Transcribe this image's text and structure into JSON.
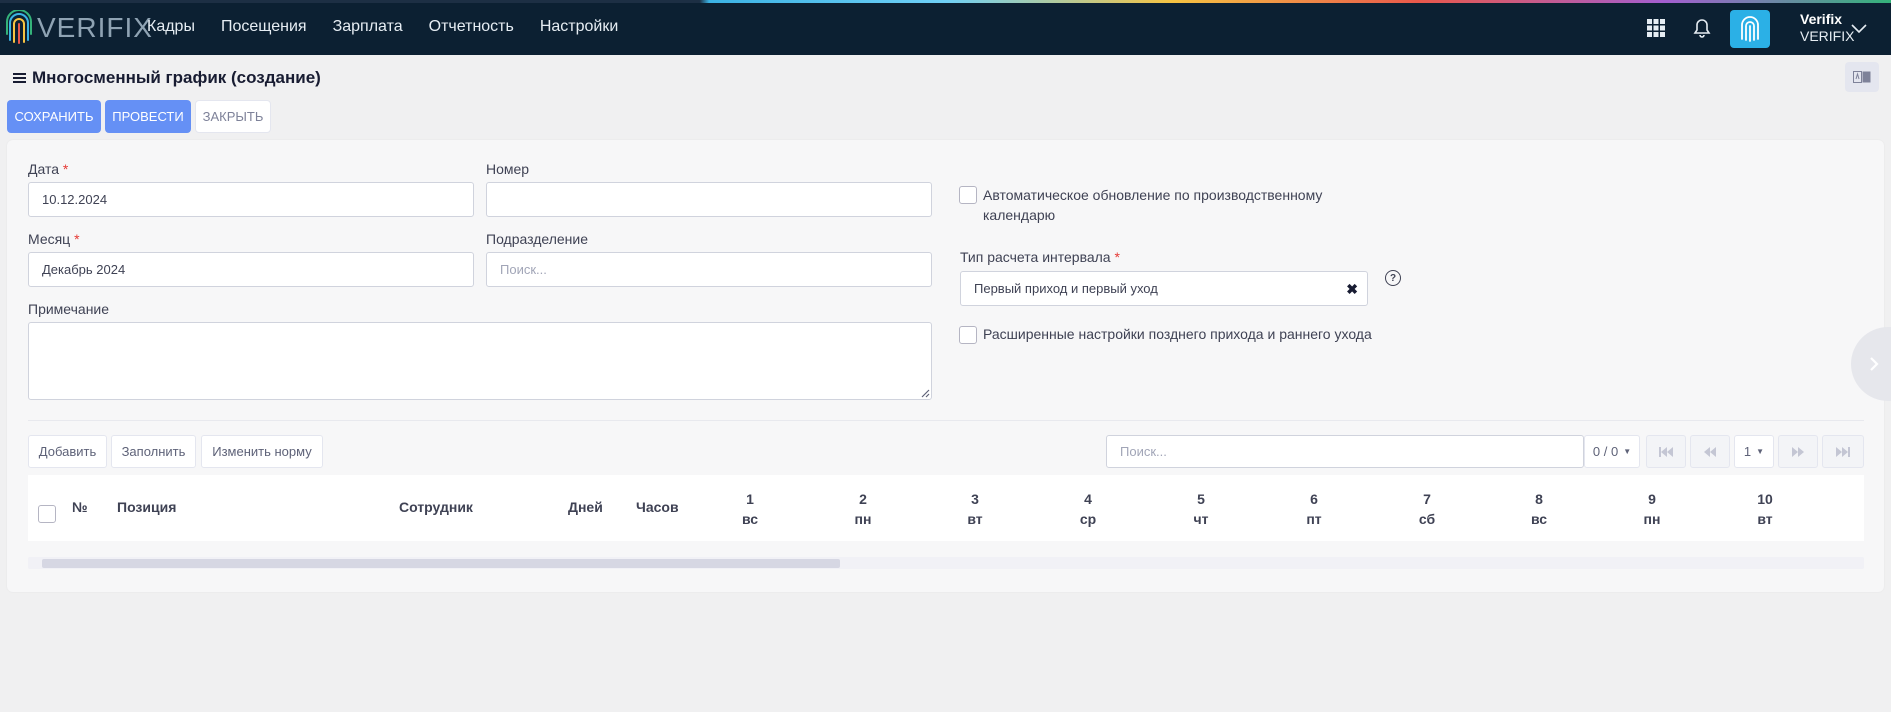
{
  "app": {
    "logo_text": "VERIFIX",
    "nav": [
      "Кадры",
      "Посещения",
      "Зарплата",
      "Отчетность",
      "Настройки"
    ],
    "user": {
      "name": "Verifix",
      "company": "VERIFIX"
    },
    "colors": {
      "topbar": "#0c2032",
      "primary": "#6590f5",
      "accent": "#2bb0e6"
    }
  },
  "page": {
    "title": "Многосменный график (создание)",
    "buttons": {
      "save": "СОХРАНИТЬ",
      "post": "ПРОВЕСТИ",
      "close": "ЗАКРЫТЬ"
    }
  },
  "form": {
    "date": {
      "label": "Дата",
      "value": "10.12.2024"
    },
    "number": {
      "label": "Номер",
      "value": ""
    },
    "month": {
      "label": "Месяц",
      "value": "Декабрь 2024"
    },
    "division": {
      "label": "Подразделение",
      "placeholder": "Поиск..."
    },
    "note": {
      "label": "Примечание",
      "value": ""
    },
    "auto_update": {
      "label_line1": "Автоматическое обновление по производственному",
      "label_line2": "календарю",
      "checked": false
    },
    "interval_type": {
      "label": "Тип расчета интервала",
      "value": "Первый приход и первый уход"
    },
    "advanced": {
      "label": "Расширенные настройки позднего прихода и раннего ухода",
      "checked": false
    }
  },
  "grid": {
    "toolbar": {
      "add": "Добавить",
      "fill": "Заполнить",
      "change_norm": "Изменить норму"
    },
    "search_placeholder": "Поиск...",
    "count": "0 / 0",
    "page": "1",
    "columns": {
      "number": "№",
      "position": "Позиция",
      "employee": "Сотрудник",
      "days": "Дней",
      "hours": "Часов"
    },
    "days": [
      {
        "n": "1",
        "w": "вс"
      },
      {
        "n": "2",
        "w": "пн"
      },
      {
        "n": "3",
        "w": "вт"
      },
      {
        "n": "4",
        "w": "ср"
      },
      {
        "n": "5",
        "w": "чт"
      },
      {
        "n": "6",
        "w": "пт"
      },
      {
        "n": "7",
        "w": "сб"
      },
      {
        "n": "8",
        "w": "вс"
      },
      {
        "n": "9",
        "w": "пн"
      },
      {
        "n": "10",
        "w": "вт"
      }
    ]
  }
}
